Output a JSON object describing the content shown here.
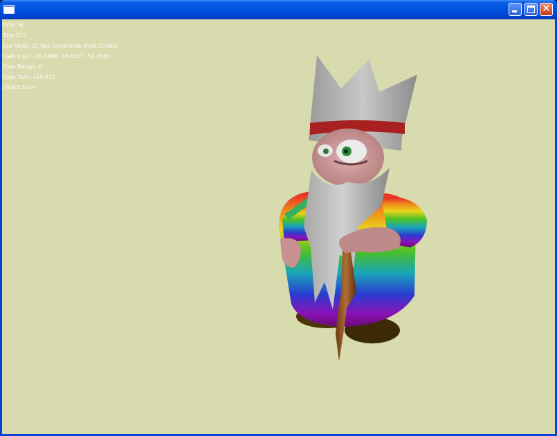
{
  "window": {
    "title": "",
    "icon": "window-icon",
    "buttons": [
      "minimize",
      "maximize",
      "close"
    ]
  },
  "hud": {
    "fps": "FPS:76",
    "tris": "Tris:552",
    "vid_mem": "Vid Mem: 257mb Used:6mb Avail:250mb",
    "cam_xyz": "Cam x,y,z: -28.1386, 30.6527, 54.0565",
    "cam_range": "Cam Range: 0",
    "cam_yaw": "Cam Yaw:-144.018",
    "wait": "(W)ait:True"
  },
  "scene": {
    "background": "#d7dbad",
    "subject": "old wizard gnome with white beard, rainbow robe and wooden staff"
  }
}
